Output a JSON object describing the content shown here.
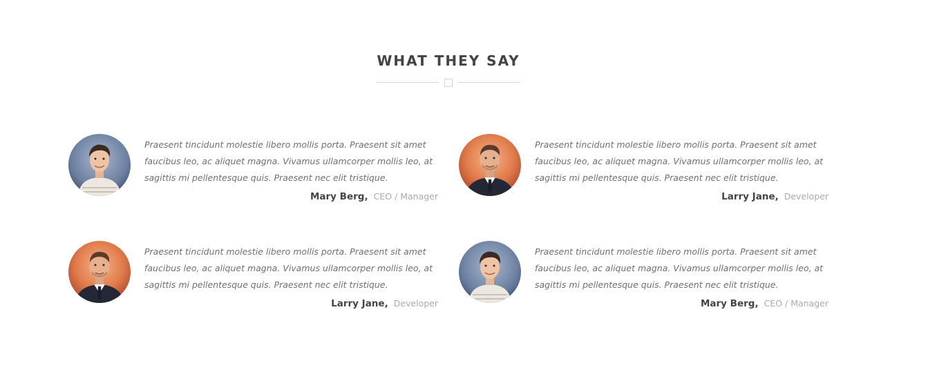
{
  "section": {
    "title": "WHAT THEY SAY"
  },
  "testimonials": [
    {
      "quote": "Praesent tincidunt molestie libero mollis porta. Praesent sit amet faucibus leo, ac aliquet magna. Vivamus ullamcorper mollis leo, at sagittis mi pellentesque quis. Praesent nec elit tristique.",
      "name": "Mary Berg,",
      "role": "CEO / Manager",
      "avatar": "young-man-blue-background"
    },
    {
      "quote": "Praesent tincidunt molestie libero mollis porta. Praesent sit amet faucibus leo, ac aliquet magna. Vivamus ullamcorper mollis leo, at sagittis mi pellentesque quis. Praesent nec elit tristique.",
      "name": "Larry Jane,",
      "role": "Developer",
      "avatar": "man-in-suit-orange-background"
    },
    {
      "quote": "Praesent tincidunt molestie libero mollis porta. Praesent sit amet faucibus leo, ac aliquet magna. Vivamus ullamcorper mollis leo, at sagittis mi pellentesque quis. Praesent nec elit tristique.",
      "name": "Larry Jane,",
      "role": "Developer",
      "avatar": "man-in-suit-orange-background"
    },
    {
      "quote": "Praesent tincidunt molestie libero mollis porta. Praesent sit amet faucibus leo, ac aliquet magna. Vivamus ullamcorper mollis leo, at sagittis mi pellentesque quis. Praesent nec elit tristique.",
      "name": "Mary Berg,",
      "role": "CEO / Manager",
      "avatar": "young-man-blue-background"
    }
  ],
  "colors": {
    "heading": "#444444",
    "quote": "#6f6f6f",
    "role": "#aaaaaa",
    "divider": "#d6d6d6"
  }
}
